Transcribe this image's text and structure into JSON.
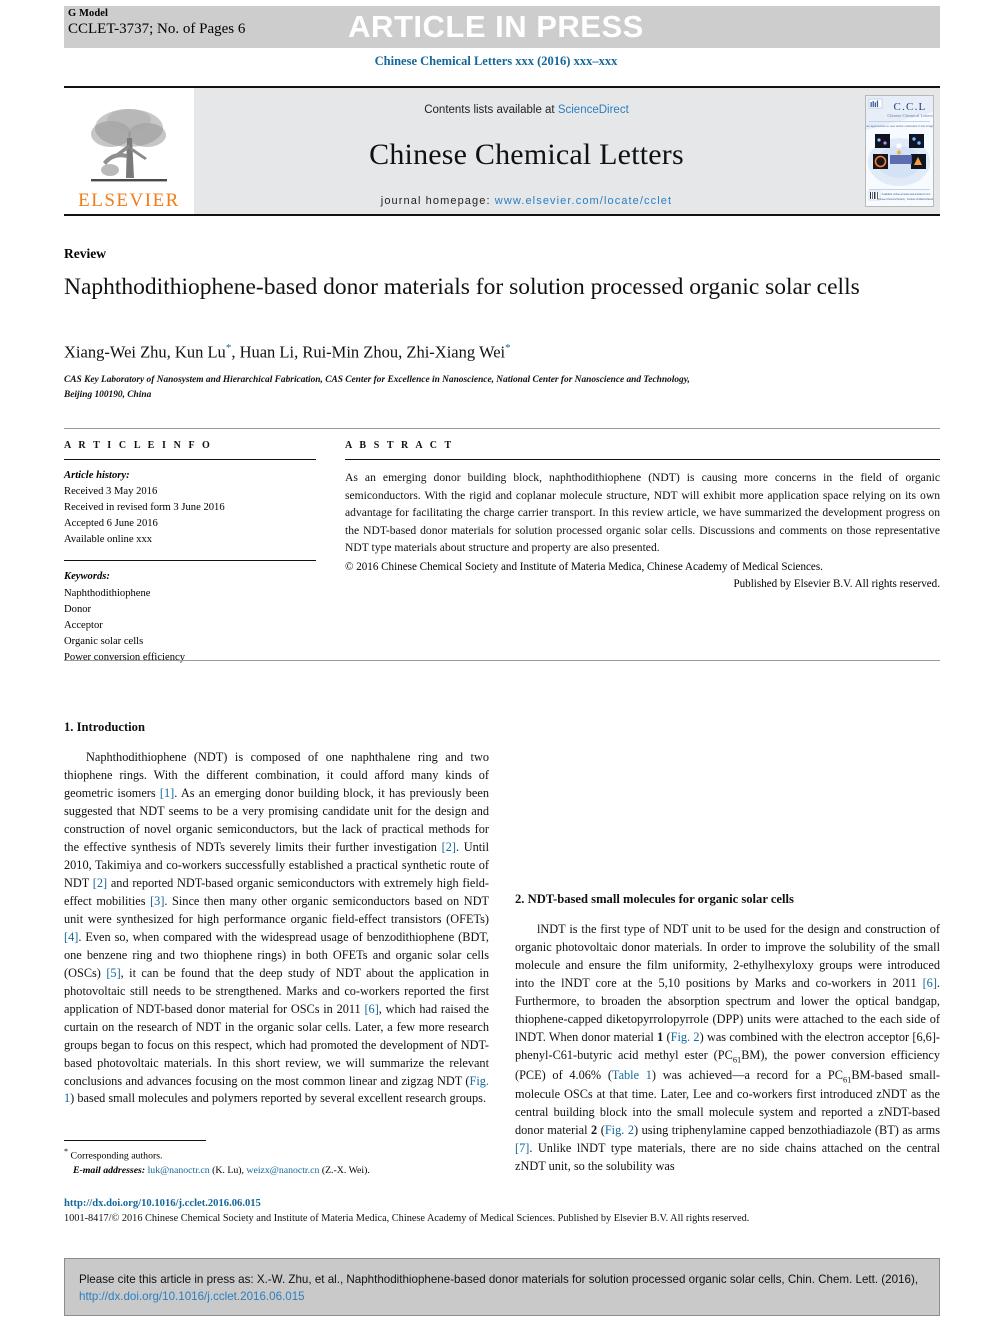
{
  "header": {
    "g_model": "G Model",
    "article_id": "CCLET-3737; No. of Pages 6",
    "article_in_press": "ARTICLE IN PRESS",
    "running_head": "Chinese Chemical Letters xxx (2016) xxx–xxx"
  },
  "masthead": {
    "contents_prefix": "Contents lists available at ",
    "contents_link": "ScienceDirect",
    "journal_name": "Chinese Chemical Letters",
    "homepage_label": "journal homepage: ",
    "homepage_url": "www.elsevier.com/locate/cclet",
    "publisher_logo_word": "ELSEVIER",
    "cover_title": "CCL",
    "cover_subtitle": "Chinese Chemical Letters"
  },
  "article": {
    "kind": "Review",
    "title": "Naphthodithiophene-based donor materials for solution processed organic solar cells",
    "authors": "Xiang-Wei Zhu, Kun Lu",
    "authors_mid": ", Huan Li, Rui-Min Zhou, Zhi-Xiang Wei",
    "affiliation_line1": "CAS Key Laboratory of Nanosystem and Hierarchical Fabrication, CAS Center for Excellence in Nanoscience, National Center for Nanoscience and Technology,",
    "affiliation_line2": "Beijing 100190, China"
  },
  "article_info": {
    "heading": "A R T I C L E  I N F O",
    "history_label": "Article history:",
    "history": [
      "Received 3 May 2016",
      "Received in revised form 3 June 2016",
      "Accepted 6 June 2016",
      "Available online xxx"
    ],
    "keywords_label": "Keywords:",
    "keywords": [
      "Naphthodithiophene",
      "Donor",
      "Acceptor",
      "Organic solar cells",
      "Power conversion efficiency"
    ]
  },
  "abstract": {
    "heading": "A B S T R A C T",
    "body": "As an emerging donor building block, naphthodithiophene (NDT) is causing more concerns in the field of organic semiconductors. With the rigid and coplanar molecule structure, NDT will exhibit more application space relying on its own advantage for facilitating the charge carrier transport. In this review article, we have summarized the development progress on the NDT-based donor materials for solution processed organic solar cells. Discussions and comments on those representative NDT type materials about structure and property are also presented.",
    "copyright_line1": "© 2016 Chinese Chemical Society and Institute of Materia Medica, Chinese Academy of Medical Sciences.",
    "copyright_line2": "Published by Elsevier B.V. All rights reserved."
  },
  "body": {
    "section1_heading": "1. Introduction",
    "section1_p1_a": "Naphthodithiophene (NDT) is composed of one naphthalene ring and two thiophene rings. With the different combination, it could afford many kinds of geometric isomers ",
    "ref1": "[1]",
    "section1_p1_b": ". As an emerging donor building block, it has previously been suggested that NDT seems to be a very promising candidate unit for the design and construction of novel organic semiconductors, but the lack of practical methods for the effective synthesis of NDTs severely limits their further investigation ",
    "ref2": "[2]",
    "section1_p1_c": ". Until 2010, Takimiya and co-workers successfully established a practical synthetic route of NDT ",
    "ref2b": "[2]",
    "section1_p1_d": " and reported NDT-based organic semiconductors with extremely high field-effect mobilities ",
    "ref3": "[3]",
    "section1_p1_e": ". Since then many other organic semiconductors based on NDT unit were synthesized for high performance organic field-effect transistors (OFETs) ",
    "ref4": "[4]",
    "section1_p1_f": ". Even so, when compared with the widespread usage of benzodithiophene (BDT, one benzene ring and two thiophene rings) in both OFETs and organic solar cells (OSCs) ",
    "ref5": "[5]",
    "section1_p1_g": ", it can be found that the deep study of NDT about the application in photovoltaic still needs to be strengthened. Marks and co-workers reported the first application of NDT-based donor material for OSCs in 2011 ",
    "ref6": "[6]",
    "section1_p1_h": ", which had raised the curtain on the research of NDT in the organic solar cells. Later, a few more research groups began to focus on this respect, which had promoted the development of NDT-based photovoltaic materials. In this short review, we will summarize the relevant conclusions and advances focusing on the most common linear and zigzag NDT (",
    "fig1_ref": "Fig. 1",
    "section1_p1_i": ") based small molecules and polymers reported by several excellent research groups.",
    "section2_heading": "2. NDT-based small molecules for organic solar cells",
    "section2_p1_a": "lNDT is the first type of NDT unit to be used for the design and construction of organic photovoltaic donor materials. In order to improve the solubility of the small molecule and ensure the film uniformity, 2-ethylhexyloxy groups were introduced into the lNDT core at the 5,10 positions by Marks and co-workers in 2011 ",
    "ref6b": "[6]",
    "section2_p1_b": ". Furthermore, to broaden the absorption spectrum and lower the optical bandgap, thiophene-capped diketopyrrolopyrrole (DPP) units were attached to the each side of lNDT. When donor material ",
    "mat1": "1",
    "section2_p1_c": " (",
    "fig2_ref": "Fig. 2",
    "section2_p1_d": ") was combined with the electron acceptor [6,6]-phenyl-C61-butyric acid methyl ester (PC",
    "sub61": "61",
    "section2_p1_e": "BM), the power conversion efficiency (PCE) of 4.06% (",
    "table1_ref": "Table 1",
    "section2_p1_f": ") was achieved—a record for a PC",
    "sub61b": "61",
    "section2_p1_g": "BM-based small-molecule OSCs at that time. Later, Lee and co-workers first introduced zNDT as the central building block into the small molecule system and reported a zNDT-based donor material ",
    "mat2": "2",
    "section2_p1_h": " (",
    "fig2_ref_b": "Fig. 2",
    "section2_p1_i": ") using triphenylamine capped benzothiadiazole (BT) as arms ",
    "ref7": "[7]",
    "section2_p1_j": ". Unlike lNDT type materials, there are no side chains attached on the central zNDT unit, so the solubility was"
  },
  "footnote": {
    "corresponding": "Corresponding authors.",
    "email_label": "E-mail addresses:",
    "email1": "luk@nanoctr.cn",
    "email1_name": "(K. Lu),",
    "email2": "weizx@nanoctr.cn",
    "email2_name": "(Z.-X. Wei).",
    "doi": "http://dx.doi.org/10.1016/j.cclet.2016.06.015",
    "issn": "1001-8417/© 2016 Chinese Chemical Society and Institute of Materia Medica, Chinese Academy of Medical Sciences. Published by Elsevier B.V. All rights reserved."
  },
  "cite_box": {
    "text": "Please cite this article in press as: X.-W. Zhu, et al., Naphthodithiophene-based donor materials for solution processed organic solar cells, Chin. Chem. Lett. (2016), ",
    "link": "http://dx.doi.org/10.1016/j.cclet.2016.06.015"
  },
  "colors": {
    "link": "#2b7fc1",
    "ref": "#12679b",
    "elsevier_orange": "#f07c1a",
    "band_gray": "#cdcdcd",
    "masthead_gray": "#e6e7e8",
    "cite_gray": "#c9c9c9"
  }
}
